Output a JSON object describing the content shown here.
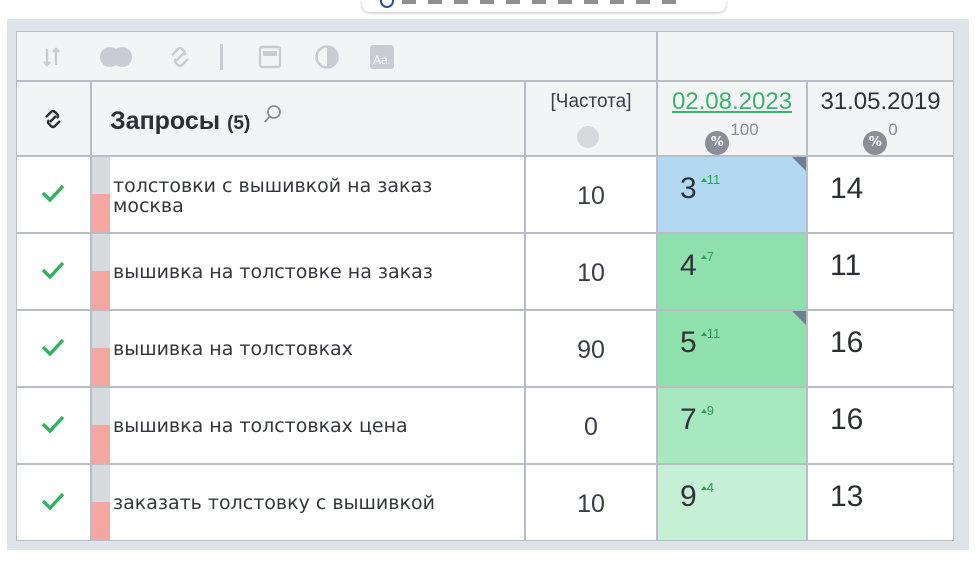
{
  "colors": {
    "accent_green": "#3cb371",
    "cell_blue": "#b3d8f2",
    "cell_green_1": "#8fe0ad",
    "cell_green_2": "#8fe0ad",
    "cell_green_3": "#a8e8c1",
    "cell_green_4": "#c5f0d6",
    "check_green": "#2fb35f",
    "bar_red": "#f4a7a0"
  },
  "toolbar": {
    "icons": [
      "sort-icon",
      "toggle-icon",
      "link-icon",
      "calendar-icon",
      "contrast-icon",
      "font-size-icon"
    ]
  },
  "header": {
    "query_title": "Запросы",
    "query_count": "(5)",
    "frequency_label": "[Частота]",
    "dates": [
      {
        "label": "02.08.2023",
        "percent": "100",
        "active": true
      },
      {
        "label": "31.05.2019",
        "percent": "0",
        "active": false
      }
    ]
  },
  "rows": [
    {
      "query": "толстовки с вышивкой на заказ москва",
      "frequency": "10",
      "position": "3",
      "delta": "11",
      "prev_position": "14",
      "flag": true,
      "color_key": "cell_blue"
    },
    {
      "query": "вышивка на толстовке на заказ",
      "frequency": "10",
      "position": "4",
      "delta": "7",
      "prev_position": "11",
      "flag": false,
      "color_key": "cell_green_1"
    },
    {
      "query": "вышивка на толстовках",
      "frequency": "90",
      "position": "5",
      "delta": "11",
      "prev_position": "16",
      "flag": true,
      "color_key": "cell_green_2"
    },
    {
      "query": "вышивка на толстовках цена",
      "frequency": "0",
      "position": "7",
      "delta": "9",
      "prev_position": "16",
      "flag": false,
      "color_key": "cell_green_3"
    },
    {
      "query": "заказать толстовку с вышивкой",
      "frequency": "10",
      "position": "9",
      "delta": "4",
      "prev_position": "13",
      "flag": false,
      "color_key": "cell_green_4"
    }
  ]
}
